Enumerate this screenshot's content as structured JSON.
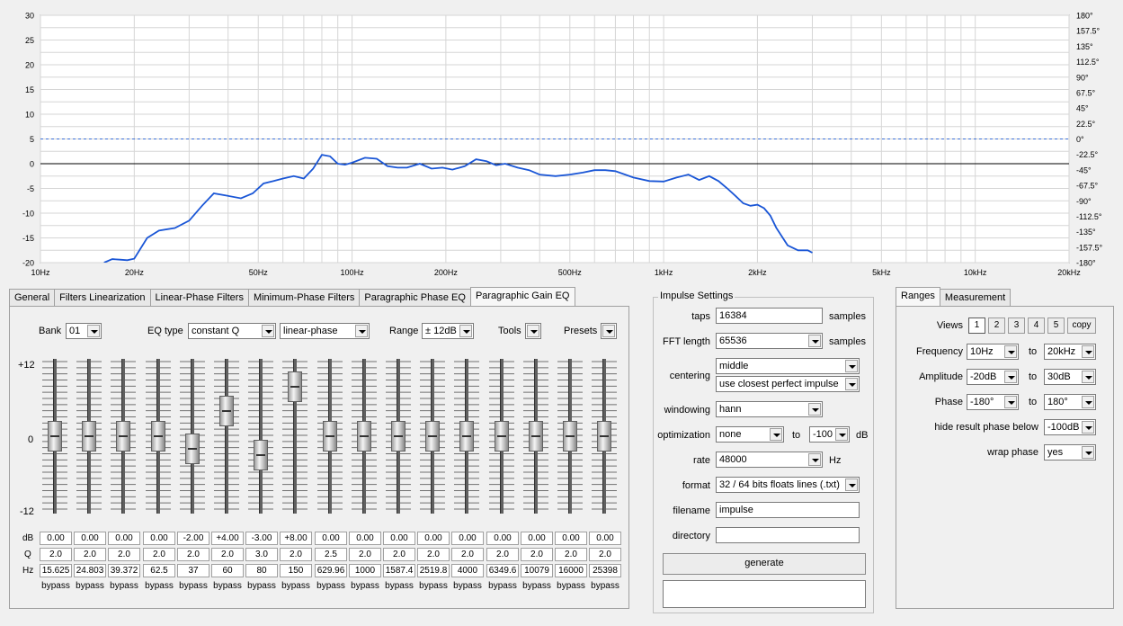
{
  "chart": {
    "y_left_ticks": [
      "30",
      "25",
      "20",
      "15",
      "10",
      "5",
      "0",
      "-5",
      "-10",
      "-15",
      "-20"
    ],
    "y_right_ticks": [
      "180°",
      "157.5°",
      "135°",
      "112.5°",
      "90°",
      "67.5°",
      "45°",
      "22.5°",
      "0°",
      "-22.5°",
      "-45°",
      "-67.5°",
      "-90°",
      "-112.5°",
      "-135°",
      "-157.5°",
      "-180°"
    ],
    "x_ticks": [
      "10Hz",
      "20Hz",
      "50Hz",
      "100Hz",
      "200Hz",
      "500Hz",
      "1kHz",
      "2kHz",
      "5kHz",
      "10kHz",
      "20kHz"
    ],
    "x_tick_hz": [
      10,
      20,
      50,
      100,
      200,
      500,
      1000,
      2000,
      5000,
      10000,
      20000
    ],
    "curve_color": "#1a56d6",
    "phase_ref_color": "#3a6fd8"
  },
  "chart_data": {
    "type": "line",
    "xscale": "log",
    "xlim": [
      10,
      20000
    ],
    "ylim": [
      -20,
      30
    ],
    "y2lim": [
      -180,
      180
    ],
    "grid": true,
    "series": [
      {
        "x": [
          16,
          17,
          18,
          19,
          20,
          22,
          24,
          27,
          30,
          33,
          36,
          40,
          44,
          48,
          52,
          56,
          60,
          65,
          70,
          75,
          80,
          85,
          90,
          95,
          100,
          110,
          120,
          130,
          140,
          150,
          165,
          180,
          195,
          210,
          230,
          250,
          270,
          290,
          310,
          340,
          370,
          400,
          450,
          500,
          550,
          600,
          650,
          700,
          800,
          900,
          1000,
          1100,
          1200,
          1300,
          1400,
          1500,
          1600,
          1700,
          1800,
          1900,
          2000,
          2100,
          2200,
          2300,
          2500,
          2700,
          2900,
          3000
        ],
        "y": [
          -20,
          -19.3,
          -19.4,
          -19.5,
          -19.2,
          -15,
          -13.5,
          -13,
          -11.5,
          -8.5,
          -6,
          -6.5,
          -7,
          -6,
          -4,
          -3.5,
          -3,
          -2.5,
          -3,
          -1,
          1.8,
          1.5,
          0,
          -0.2,
          0.2,
          1.2,
          1,
          -0.5,
          -0.8,
          -0.8,
          0,
          -1,
          -0.8,
          -1.2,
          -0.5,
          0.9,
          0.5,
          -0.3,
          0,
          -0.8,
          -1.3,
          -2.2,
          -2.5,
          -2.2,
          -1.8,
          -1.3,
          -1.3,
          -1.5,
          -2.8,
          -3.5,
          -3.6,
          -2.8,
          -2.2,
          -3.3,
          -2.5,
          -3.5,
          -5,
          -6.5,
          -8,
          -8.5,
          -8.3,
          -9,
          -10.5,
          -13,
          -16.5,
          -17.5,
          -17.5,
          -18
        ]
      }
    ],
    "reference_lines": [
      {
        "y": 5,
        "style": "dashed"
      },
      {
        "y": 0,
        "style": "solid"
      }
    ]
  },
  "tabs": [
    "General",
    "Filters Linearization",
    "Linear-Phase Filters",
    "Minimum-Phase Filters",
    "Paragraphic Phase EQ",
    "Paragraphic Gain EQ"
  ],
  "active_tab": "Paragraphic Gain EQ",
  "eq": {
    "bank_label": "Bank",
    "bank_value": "01",
    "eqtype_label": "EQ type",
    "eqtype_value": "constant Q",
    "phase_value": "linear-phase",
    "range_label": "Range",
    "range_value": "± 12dB",
    "tools_label": "Tools",
    "presets_label": "Presets",
    "scale_top": "+12",
    "scale_mid": "0",
    "scale_bottom": "-12",
    "row_labels": {
      "db": "dB",
      "q": "Q",
      "hz": "Hz"
    },
    "bypass_label": "bypass",
    "bands": [
      {
        "db": "0.00",
        "q": "2.0",
        "hz": "15.625",
        "gain": 0
      },
      {
        "db": "0.00",
        "q": "2.0",
        "hz": "24.803",
        "gain": 0
      },
      {
        "db": "0.00",
        "q": "2.0",
        "hz": "39.372",
        "gain": 0
      },
      {
        "db": "0.00",
        "q": "2.0",
        "hz": "62.5",
        "gain": 0
      },
      {
        "db": "-2.00",
        "q": "2.0",
        "hz": "37",
        "gain": -2
      },
      {
        "db": "+4.00",
        "q": "2.0",
        "hz": "60",
        "gain": 4
      },
      {
        "db": "-3.00",
        "q": "3.0",
        "hz": "80",
        "gain": -3
      },
      {
        "db": "+8.00",
        "q": "2.0",
        "hz": "150",
        "gain": 8
      },
      {
        "db": "0.00",
        "q": "2.5",
        "hz": "629.96",
        "gain": 0
      },
      {
        "db": "0.00",
        "q": "2.0",
        "hz": "1000",
        "gain": 0
      },
      {
        "db": "0.00",
        "q": "2.0",
        "hz": "1587.4",
        "gain": 0
      },
      {
        "db": "0.00",
        "q": "2.0",
        "hz": "2519.8",
        "gain": 0
      },
      {
        "db": "0.00",
        "q": "2.0",
        "hz": "4000",
        "gain": 0
      },
      {
        "db": "0.00",
        "q": "2.0",
        "hz": "6349.6",
        "gain": 0
      },
      {
        "db": "0.00",
        "q": "2.0",
        "hz": "10079",
        "gain": 0
      },
      {
        "db": "0.00",
        "q": "2.0",
        "hz": "16000",
        "gain": 0
      },
      {
        "db": "0.00",
        "q": "2.0",
        "hz": "25398",
        "gain": 0
      }
    ]
  },
  "impulse": {
    "title": "Impulse Settings",
    "taps_label": "taps",
    "taps_value": "16384",
    "taps_unit": "samples",
    "fft_label": "FFT length",
    "fft_value": "65536",
    "fft_unit": "samples",
    "centering_label": "centering",
    "centering_value": "middle",
    "centering_value2": "use closest perfect impulse",
    "windowing_label": "windowing",
    "windowing_value": "hann",
    "optimization_label": "optimization",
    "optimization_value": "none",
    "opt_to_label": "to",
    "opt_to_value": "-100",
    "opt_unit": "dB",
    "rate_label": "rate",
    "rate_value": "48000",
    "rate_unit": "Hz",
    "format_label": "format",
    "format_value": "32 / 64 bits floats lines (.txt)",
    "filename_label": "filename",
    "filename_value": "impulse",
    "directory_label": "directory",
    "directory_value": "",
    "generate_label": "generate",
    "status_value": ""
  },
  "ranges": {
    "tabs": [
      "Ranges",
      "Measurement"
    ],
    "views_label": "Views",
    "views": [
      "1",
      "2",
      "3",
      "4",
      "5"
    ],
    "copy_label": "copy",
    "frequency_label": "Frequency",
    "freq_from": "10Hz",
    "freq_to": "20kHz",
    "amplitude_label": "Amplitude",
    "amp_from": "-20dB",
    "amp_to": "30dB",
    "phase_label": "Phase",
    "phase_from": "-180°",
    "phase_to": "180°",
    "to_label": "to",
    "hide_phase_label": "hide result phase below",
    "hide_phase_value": "-100dB",
    "wrap_label": "wrap phase",
    "wrap_value": "yes"
  }
}
